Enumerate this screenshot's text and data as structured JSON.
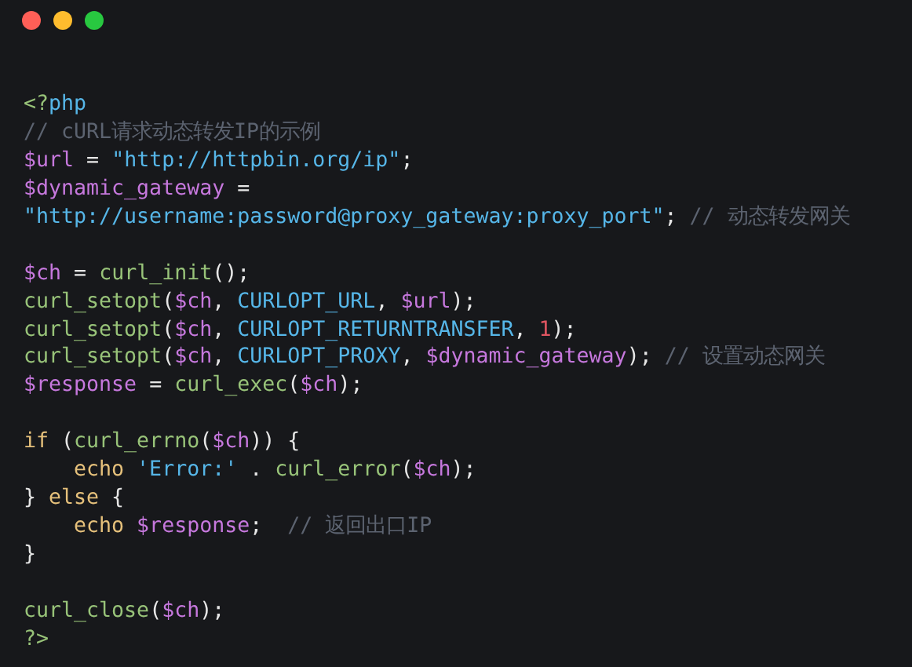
{
  "window_controls": [
    {
      "color": "#ff5f57"
    },
    {
      "color": "#febc2e"
    },
    {
      "color": "#28c840"
    }
  ],
  "code_lines": [
    {
      "kind": "line",
      "tokens": [
        {
          "text": "<?",
          "kind": "tag"
        },
        {
          "text": "php",
          "kind": "string"
        }
      ]
    },
    {
      "kind": "line",
      "tokens": [
        {
          "text": "// cURL请求动态转发IP的示例",
          "kind": "comment"
        }
      ]
    },
    {
      "kind": "line",
      "tokens": [
        {
          "text": "$url",
          "kind": "variable"
        },
        {
          "text": " = ",
          "kind": "plain"
        },
        {
          "text": "\"http://httpbin.org/ip\"",
          "kind": "string"
        },
        {
          "text": ";",
          "kind": "plain"
        }
      ]
    },
    {
      "kind": "line",
      "tokens": [
        {
          "text": "$dynamic_gateway",
          "kind": "variable"
        },
        {
          "text": " =",
          "kind": "plain"
        }
      ]
    },
    {
      "kind": "line",
      "tokens": [
        {
          "text": "\"http://username:password@proxy_gateway:proxy_port\"",
          "kind": "string"
        },
        {
          "text": "; ",
          "kind": "plain"
        },
        {
          "text": "// 动态转发网关",
          "kind": "comment"
        }
      ]
    },
    {
      "kind": "blank"
    },
    {
      "kind": "line",
      "tokens": [
        {
          "text": "$ch",
          "kind": "variable"
        },
        {
          "text": " = ",
          "kind": "plain"
        },
        {
          "text": "curl_init",
          "kind": "function"
        },
        {
          "text": "();",
          "kind": "plain"
        }
      ]
    },
    {
      "kind": "line",
      "tokens": [
        {
          "text": "curl_setopt",
          "kind": "function"
        },
        {
          "text": "(",
          "kind": "plain"
        },
        {
          "text": "$ch",
          "kind": "variable"
        },
        {
          "text": ", ",
          "kind": "plain"
        },
        {
          "text": "CURLOPT_URL",
          "kind": "constant"
        },
        {
          "text": ", ",
          "kind": "plain"
        },
        {
          "text": "$url",
          "kind": "variable"
        },
        {
          "text": ");",
          "kind": "plain"
        }
      ]
    },
    {
      "kind": "line",
      "tokens": [
        {
          "text": "curl_setopt",
          "kind": "function"
        },
        {
          "text": "(",
          "kind": "plain"
        },
        {
          "text": "$ch",
          "kind": "variable"
        },
        {
          "text": ", ",
          "kind": "plain"
        },
        {
          "text": "CURLOPT_RETURNTRANSFER",
          "kind": "constant"
        },
        {
          "text": ", ",
          "kind": "plain"
        },
        {
          "text": "1",
          "kind": "number"
        },
        {
          "text": ");",
          "kind": "plain"
        }
      ]
    },
    {
      "kind": "line",
      "tokens": [
        {
          "text": "curl_setopt",
          "kind": "function"
        },
        {
          "text": "(",
          "kind": "plain"
        },
        {
          "text": "$ch",
          "kind": "variable"
        },
        {
          "text": ", ",
          "kind": "plain"
        },
        {
          "text": "CURLOPT_PROXY",
          "kind": "constant"
        },
        {
          "text": ", ",
          "kind": "plain"
        },
        {
          "text": "$dynamic_gateway",
          "kind": "variable"
        },
        {
          "text": "); ",
          "kind": "plain"
        },
        {
          "text": "// 设置动态网关",
          "kind": "comment"
        }
      ]
    },
    {
      "kind": "line",
      "tokens": [
        {
          "text": "$response",
          "kind": "variable"
        },
        {
          "text": " = ",
          "kind": "plain"
        },
        {
          "text": "curl_exec",
          "kind": "function"
        },
        {
          "text": "(",
          "kind": "plain"
        },
        {
          "text": "$ch",
          "kind": "variable"
        },
        {
          "text": ");",
          "kind": "plain"
        }
      ]
    },
    {
      "kind": "blank"
    },
    {
      "kind": "line",
      "tokens": [
        {
          "text": "if",
          "kind": "keyword"
        },
        {
          "text": " (",
          "kind": "plain"
        },
        {
          "text": "curl_errno",
          "kind": "function"
        },
        {
          "text": "(",
          "kind": "plain"
        },
        {
          "text": "$ch",
          "kind": "variable"
        },
        {
          "text": ")) {",
          "kind": "plain"
        }
      ]
    },
    {
      "kind": "indented",
      "tokens": [
        {
          "text": "echo",
          "kind": "keyword"
        },
        {
          "text": " 'Error:'",
          "kind": "string"
        },
        {
          "text": " . ",
          "kind": "plain"
        },
        {
          "text": "curl_error",
          "kind": "function"
        },
        {
          "text": "(",
          "kind": "plain"
        },
        {
          "text": "$ch",
          "kind": "variable"
        },
        {
          "text": ");",
          "kind": "plain"
        }
      ]
    },
    {
      "kind": "line",
      "tokens": [
        {
          "text": "} ",
          "kind": "plain"
        },
        {
          "text": "else",
          "kind": "keyword"
        },
        {
          "text": " {",
          "kind": "plain"
        }
      ]
    },
    {
      "kind": "indented",
      "tokens": [
        {
          "text": "echo",
          "kind": "keyword"
        },
        {
          "text": " $response",
          "kind": "variable"
        },
        {
          "text": ";  ",
          "kind": "plain"
        },
        {
          "text": "// 返回出口IP",
          "kind": "comment"
        }
      ]
    },
    {
      "kind": "line",
      "tokens": [
        {
          "text": "}",
          "kind": "plain"
        }
      ]
    },
    {
      "kind": "blank"
    },
    {
      "kind": "line",
      "tokens": [
        {
          "text": "curl_close",
          "kind": "function"
        },
        {
          "text": "(",
          "kind": "plain"
        },
        {
          "text": "$ch",
          "kind": "variable"
        },
        {
          "text": ");",
          "kind": "plain"
        }
      ]
    },
    {
      "kind": "line",
      "tokens": [
        {
          "text": "?>",
          "kind": "tag"
        }
      ]
    }
  ]
}
